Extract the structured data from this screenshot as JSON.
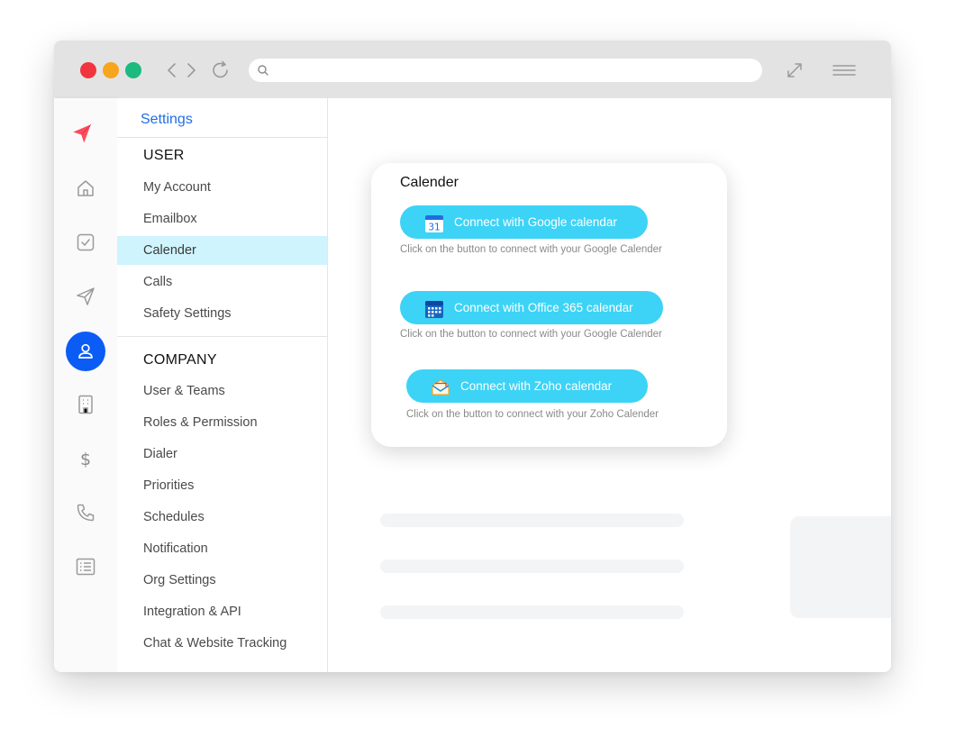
{
  "window": {
    "url": ""
  },
  "settings": {
    "title": "Settings",
    "user_section": {
      "heading": "USER",
      "items": [
        "My Account",
        "Emailbox",
        "Calender",
        "Calls",
        "Safety Settings"
      ],
      "active": "Calender"
    },
    "company_section": {
      "heading": "COMPANY",
      "items": [
        "User & Teams",
        "Roles & Permission",
        "Dialer",
        "Priorities",
        "Schedules",
        "Notification",
        "Org Settings",
        "Integration & API",
        "Chat & Website Tracking"
      ]
    }
  },
  "calendar_card": {
    "title": "Calender",
    "google": {
      "label": "Connect with Google calendar",
      "hint": "Click on the button to connect with your Google Calender",
      "icon": "google-calendar-icon",
      "icon_text": "31"
    },
    "office": {
      "label": "Connect with Office 365 calendar",
      "hint": "Click on the button to connect with your Google Calender",
      "icon": "office-calendar-icon"
    },
    "zoho": {
      "label": "Connect with Zoho calendar",
      "hint": "Click on the button to connect with your Zoho Calender",
      "icon": "zoho-mail-icon"
    }
  },
  "colors": {
    "accent": "#1f6fe5",
    "active_nav": "#0a5cf5",
    "button": "#3cd3f6",
    "active_menu_bg": "#cff4fd",
    "brand_logo": "#ff4b5c"
  }
}
